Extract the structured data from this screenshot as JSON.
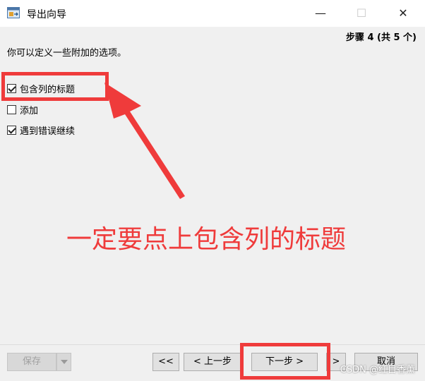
{
  "window": {
    "title": "导出向导",
    "minimize_glyph": "—",
    "maximize_glyph": "☐",
    "close_glyph": "✕"
  },
  "step_label": "步骤 4 (共 5 个)",
  "description": "你可以定义一些附加的选项。",
  "options": [
    {
      "label": "包含列的标题",
      "checked": true
    },
    {
      "label": "添加",
      "checked": false
    },
    {
      "label": "遇到错误继续",
      "checked": true
    }
  ],
  "annotation": "一定要点上包含列的标题",
  "buttons": {
    "save": "保存",
    "first": "<<",
    "prev": "< 上一步",
    "next": "下一步 >",
    "last": ">",
    "cancel": "取消"
  },
  "watermark": "CSDN @红目香薰",
  "colors": {
    "highlight": "#ef3b3b"
  }
}
